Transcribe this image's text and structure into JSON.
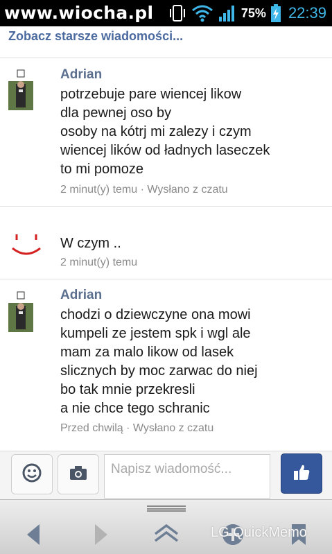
{
  "status_bar": {
    "watermark": "www.wiocha.pl",
    "battery": "75%",
    "time": "22:39",
    "accent_color": "#3fb7e8"
  },
  "older_link": "Zobacz starsze wiadomości...",
  "messages": [
    {
      "sender": "Adrian",
      "lines": [
        "potrzebuje pare wiencej likow",
        "dla pewnej oso by",
        "osoby na kótrj mi zalezy i czym",
        "wiencej lików od ładnych laseczek",
        "to mi pomoze"
      ],
      "meta": "2 minut(y) temu · Wysłano z czatu"
    },
    {
      "sender": "",
      "lines": [
        "W czym .."
      ],
      "meta": "2 minut(y) temu"
    },
    {
      "sender": "Adrian",
      "lines": [
        "chodzi o dziewczyne ona mowi",
        "kumpeli ze jestem spk i wgl ale",
        "mam za malo likow od lasek",
        "slicznych by moc zarwac do niej",
        "bo tak mnie przekresli",
        "a nie chce tego schranic"
      ],
      "meta": "Przed chwilą · Wysłano z czatu"
    }
  ],
  "composer": {
    "placeholder": "Napisz wiadomość...",
    "emoji_icon": "smiley-icon",
    "camera_icon": "camera-icon",
    "like_icon": "thumbs-up-icon",
    "like_color": "#35589c"
  },
  "nav": {
    "overlay_text": "LG QuickMemo"
  }
}
